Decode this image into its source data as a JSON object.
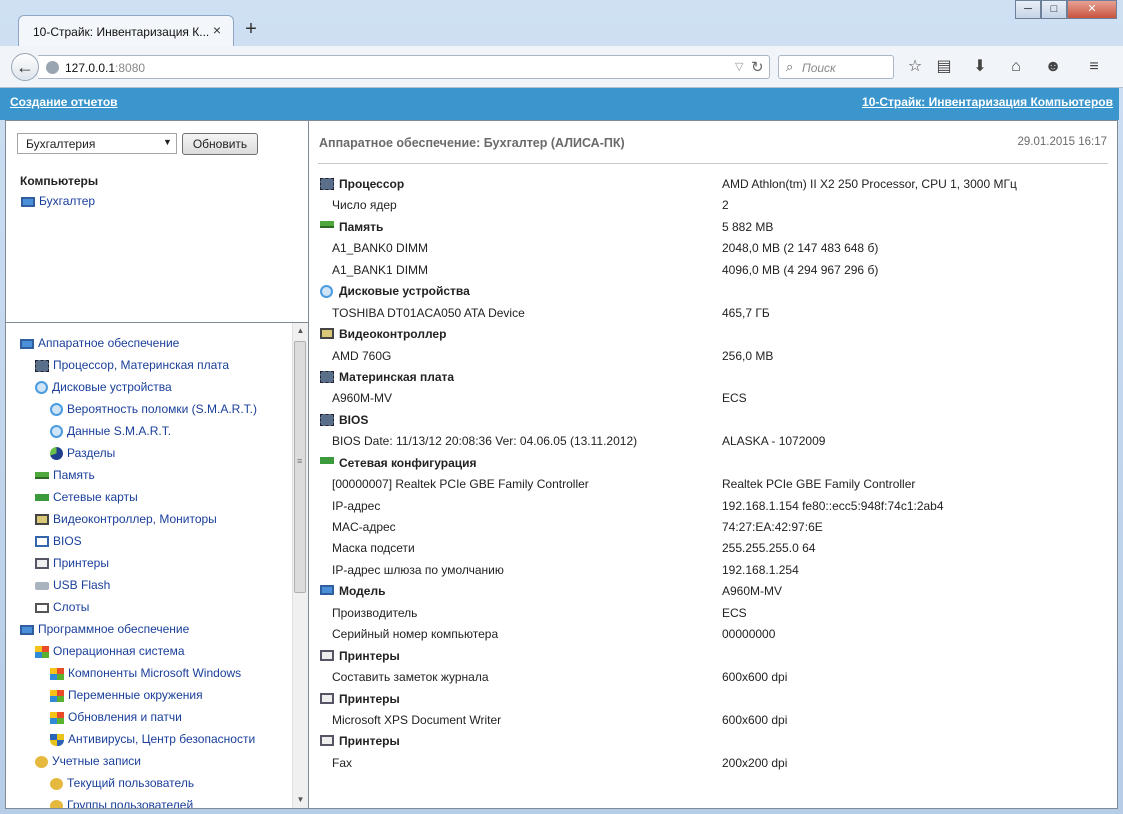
{
  "browser": {
    "tab_title": "10-Страйк: Инвентаризация К...",
    "tab_close": "×",
    "new_tab": "+",
    "win_min": "─",
    "win_max": "□",
    "win_close": "✕",
    "url_host": "127.0.0.1",
    "url_port": ":8080",
    "search_placeholder": "Поиск"
  },
  "header": {
    "left_link": "Создание отчетов",
    "right_link": "10-Страйк: Инвентаризация Компьютеров"
  },
  "sidebar": {
    "group_select": "Бухгалтерия",
    "refresh_button": "Обновить",
    "computers_title": "Компьютеры",
    "computer": "Бухгалтер",
    "tree": [
      {
        "label": "Аппаратное обеспечение",
        "icon": "monitor-icon"
      },
      {
        "label": "Процессор, Материнская плата",
        "icon": "chip-icon"
      },
      {
        "label": "Дисковые устройства",
        "icon": "disk-icon"
      },
      {
        "label": "Вероятность поломки (S.M.A.R.T.)",
        "icon": "disk-icon"
      },
      {
        "label": "Данные S.M.A.R.T.",
        "icon": "disk-icon"
      },
      {
        "label": "Разделы",
        "icon": "pie-icon"
      },
      {
        "label": "Память",
        "icon": "ram-icon"
      },
      {
        "label": "Сетевые карты",
        "icon": "network-icon"
      },
      {
        "label": "Видеоконтроллер, Мониторы",
        "icon": "video-icon"
      },
      {
        "label": "BIOS",
        "icon": "bios-icon"
      },
      {
        "label": "Принтеры",
        "icon": "printer-icon"
      },
      {
        "label": "USB Flash",
        "icon": "usb-icon"
      },
      {
        "label": "Слоты",
        "icon": "slot-icon"
      },
      {
        "label": "Программное обеспечение",
        "icon": "software-icon"
      },
      {
        "label": "Операционная система",
        "icon": "windows-icon"
      },
      {
        "label": "Компоненты Microsoft Windows",
        "icon": "windows-icon"
      },
      {
        "label": "Переменные окружения",
        "icon": "windows-icon"
      },
      {
        "label": "Обновления и патчи",
        "icon": "windows-icon"
      },
      {
        "label": "Антивирусы, Центр безопасности",
        "icon": "shield-icon"
      },
      {
        "label": "Учетные записи",
        "icon": "users-icon"
      },
      {
        "label": "Текущий пользователь",
        "icon": "users-icon"
      },
      {
        "label": "Группы пользователей",
        "icon": "users-icon"
      }
    ]
  },
  "main": {
    "title": "Аппаратное обеспечение: Бухгалтер (АЛИСА-ПК)",
    "date": "29.01.2015 16:17",
    "rows": [
      {
        "k": "Процессор",
        "v": "AMD Athlon(tm) II X2 250 Processor, CPU 1, 3000 МГц",
        "section": true,
        "icon": "chip-icon"
      },
      {
        "k": "Число ядер",
        "v": "2"
      },
      {
        "k": "Память",
        "v": "5 882 MB",
        "section": true,
        "icon": "ram-icon"
      },
      {
        "k": "A1_BANK0 DIMM",
        "v": "2048,0 MB (2 147 483 648 б)"
      },
      {
        "k": "A1_BANK1 DIMM",
        "v": "4096,0 MB (4 294 967 296 б)"
      },
      {
        "k": "Дисковые устройства",
        "v": "",
        "section": true,
        "icon": "disk-icon"
      },
      {
        "k": "TOSHIBA DT01ACA050 ATA Device",
        "v": "465,7 ГБ"
      },
      {
        "k": "Видеоконтроллер",
        "v": "",
        "section": true,
        "icon": "video-icon"
      },
      {
        "k": "AMD 760G",
        "v": "256,0 MB"
      },
      {
        "k": "Материнская плата",
        "v": "",
        "section": true,
        "icon": "chip-icon"
      },
      {
        "k": "A960M-MV",
        "v": "ECS"
      },
      {
        "k": "BIOS",
        "v": "",
        "section": true,
        "icon": "chip-icon"
      },
      {
        "k": "BIOS Date: 11/13/12 20:08:36 Ver: 04.06.05 (13.11.2012)",
        "v": "ALASKA - 1072009"
      },
      {
        "k": "Сетевая конфигурация",
        "v": "",
        "section": true,
        "icon": "network-icon"
      },
      {
        "k": "[00000007] Realtek PCIe GBE Family Controller",
        "v": "Realtek PCIe GBE Family Controller"
      },
      {
        "k": "IP-адрес",
        "v": "192.168.1.154 fe80::ecc5:948f:74c1:2ab4"
      },
      {
        "k": "MAC-адрес",
        "v": "74:27:EA:42:97:6E"
      },
      {
        "k": "Маска подсети",
        "v": "255.255.255.0 64"
      },
      {
        "k": "IP-адрес шлюза по умолчанию",
        "v": "192.168.1.254"
      },
      {
        "k": "Модель",
        "v": "A960M-MV",
        "section": true,
        "icon": "monitor-icon"
      },
      {
        "k": "Производитель",
        "v": "ECS"
      },
      {
        "k": "Серийный номер компьютера",
        "v": "00000000"
      },
      {
        "k": "Принтеры",
        "v": "",
        "section": true,
        "icon": "printer-icon"
      },
      {
        "k": "Составить заметок журнала",
        "v": "600x600 dpi"
      },
      {
        "k": "Принтеры",
        "v": "",
        "section": true,
        "icon": "printer-icon"
      },
      {
        "k": "Microsoft XPS Document Writer",
        "v": "600x600 dpi"
      },
      {
        "k": "Принтеры",
        "v": "",
        "section": true,
        "icon": "printer-icon"
      },
      {
        "k": "Fax",
        "v": "200x200 dpi"
      }
    ]
  },
  "colors": {
    "header_band": "#3a96cd",
    "link": "#1a3f9a"
  }
}
